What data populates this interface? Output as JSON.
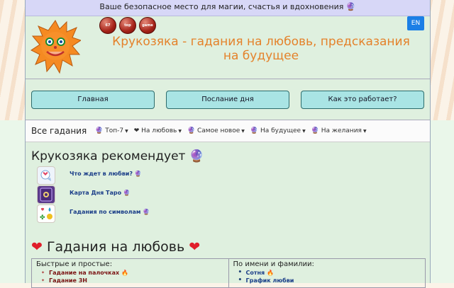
{
  "tagline": "Ваше безопасное место для магии, счастья и вдохновения 🔮",
  "header": {
    "title": "Крукозяка - гадания на любовь, предсказания на будущее",
    "lang_button": "EN",
    "badges": [
      "67",
      "top",
      "game"
    ]
  },
  "nav": {
    "main": "Главная",
    "message": "Послание дня",
    "how": "Как это работает?"
  },
  "menu": {
    "all": "Все гадания",
    "items": [
      "🔮 Топ-7",
      "❤ На любовь",
      "🔮 Самое новое",
      "🔮 На будущее",
      "🔮 На желания"
    ]
  },
  "recommend": {
    "title": "Крукозяка рекомендует 🔮",
    "items": [
      {
        "label": "Что ждет в любви? 🔮",
        "icon": "love-chat-icon"
      },
      {
        "label": "Карта Дня Таро 🔮",
        "icon": "tarot-card-icon"
      },
      {
        "label": "Гадания по символам 🔮",
        "icon": "symbols-icon"
      }
    ]
  },
  "love_section": {
    "title": "Гадания на любовь",
    "col1_heading": "Быстрые и простые:",
    "col1_items": [
      "Гадание на палочках 🔥",
      "Гадание 3Н"
    ],
    "col2_heading": "По имени и фамилии:",
    "col2_items": [
      "Сотня 🔥",
      "График любви"
    ]
  },
  "colors": {
    "accent_title": "#e4822b",
    "link": "#1a3d88",
    "heart": "#e01e2a"
  }
}
